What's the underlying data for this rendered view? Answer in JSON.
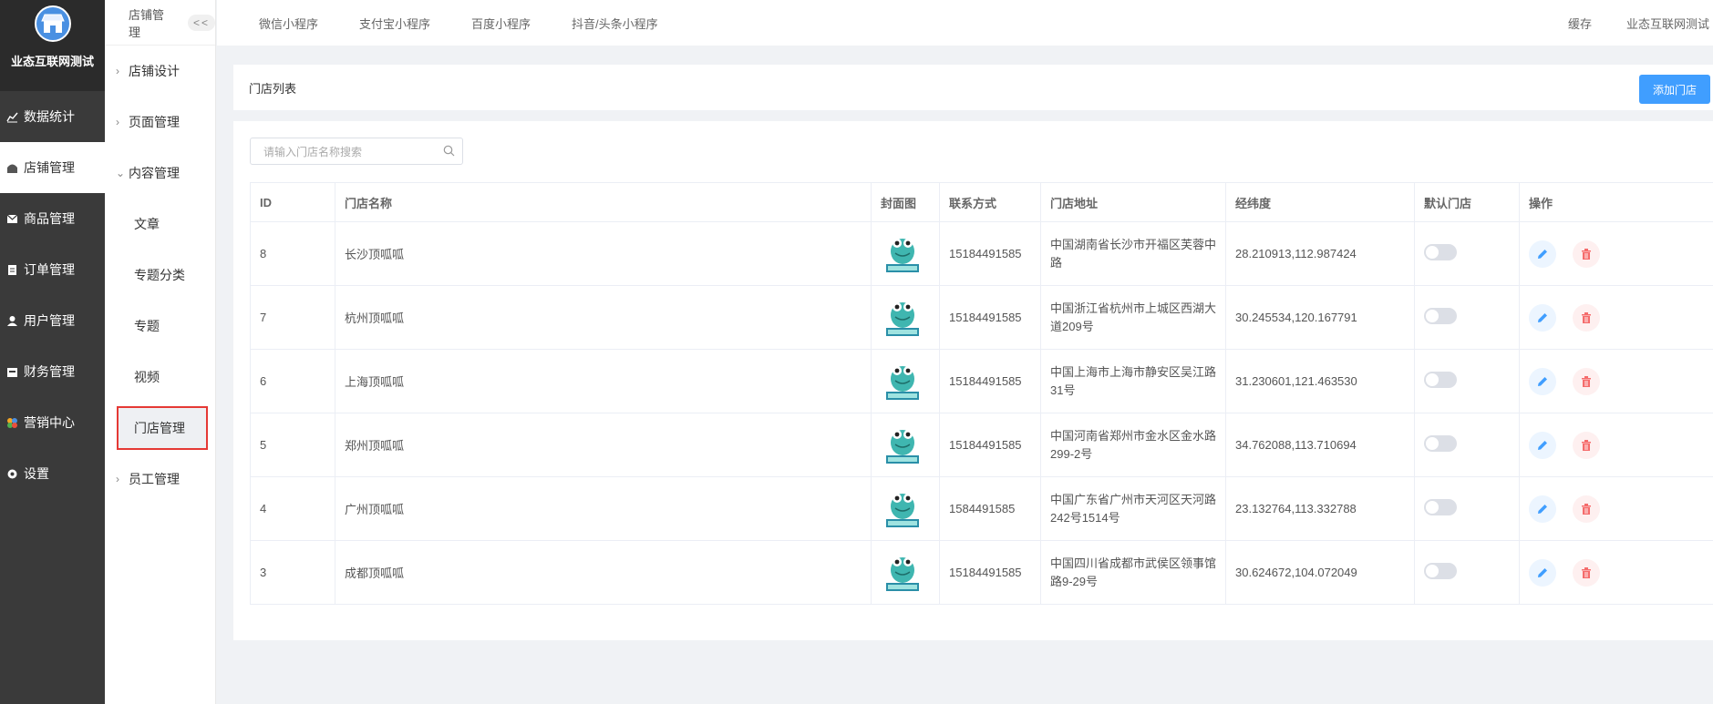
{
  "brand": {
    "name": "业态互联网测试"
  },
  "sidebar": {
    "items": [
      {
        "label": "数据统计",
        "icon": "chart-icon"
      },
      {
        "label": "店铺管理",
        "icon": "shop-icon",
        "active": true
      },
      {
        "label": "商品管理",
        "icon": "mail-icon"
      },
      {
        "label": "订单管理",
        "icon": "order-icon"
      },
      {
        "label": "用户管理",
        "icon": "user-icon"
      },
      {
        "label": "财务管理",
        "icon": "finance-icon"
      },
      {
        "label": "营销中心",
        "icon": "marketing-icon"
      },
      {
        "label": "设置",
        "icon": "settings-icon"
      }
    ]
  },
  "subnav": {
    "title": "店铺管理",
    "collapse": "<<",
    "groups": [
      {
        "label": "店铺设计"
      },
      {
        "label": "页面管理"
      },
      {
        "label": "内容管理"
      }
    ],
    "children": [
      "文章",
      "专题分类",
      "专题",
      "视频",
      "门店管理"
    ],
    "last_group": "员工管理"
  },
  "topbar": {
    "tabs": [
      "微信小程序",
      "支付宝小程序",
      "百度小程序",
      "抖音/头条小程序"
    ],
    "cache": "缓存",
    "user": "业态互联网测试"
  },
  "page": {
    "title": "门店列表",
    "add_label": "添加门店",
    "search_placeholder": "请输入门店名称搜索"
  },
  "table": {
    "headers": [
      "ID",
      "门店名称",
      "封面图",
      "联系方式",
      "门店地址",
      "经纬度",
      "默认门店",
      "操作"
    ],
    "rows": [
      {
        "id": "8",
        "name": "长沙顶呱呱",
        "phone": "15184491585",
        "address": "中国湖南省长沙市开福区芙蓉中路",
        "coords": "28.210913,112.987424",
        "default": false
      },
      {
        "id": "7",
        "name": "杭州顶呱呱",
        "phone": "15184491585",
        "address": "中国浙江省杭州市上城区西湖大道209号",
        "coords": "30.245534,120.167791",
        "default": false
      },
      {
        "id": "6",
        "name": "上海顶呱呱",
        "phone": "15184491585",
        "address": "中国上海市上海市静安区吴江路31号",
        "coords": "31.230601,121.463530",
        "default": false
      },
      {
        "id": "5",
        "name": "郑州顶呱呱",
        "phone": "15184491585",
        "address": "中国河南省郑州市金水区金水路299-2号",
        "coords": "34.762088,113.710694",
        "default": false
      },
      {
        "id": "4",
        "name": "广州顶呱呱",
        "phone": "1584491585",
        "address": "中国广东省广州市天河区天河路242号1514号",
        "coords": "23.132764,113.332788",
        "default": false
      },
      {
        "id": "3",
        "name": "成都顶呱呱",
        "phone": "15184491585",
        "address": "中国四川省成都市武侯区领事馆路9-29号",
        "coords": "30.624672,104.072049",
        "default": false
      }
    ]
  },
  "colors": {
    "primary": "#409eff",
    "sidebar": "#3a3a3a",
    "danger": "#f56c6c"
  }
}
